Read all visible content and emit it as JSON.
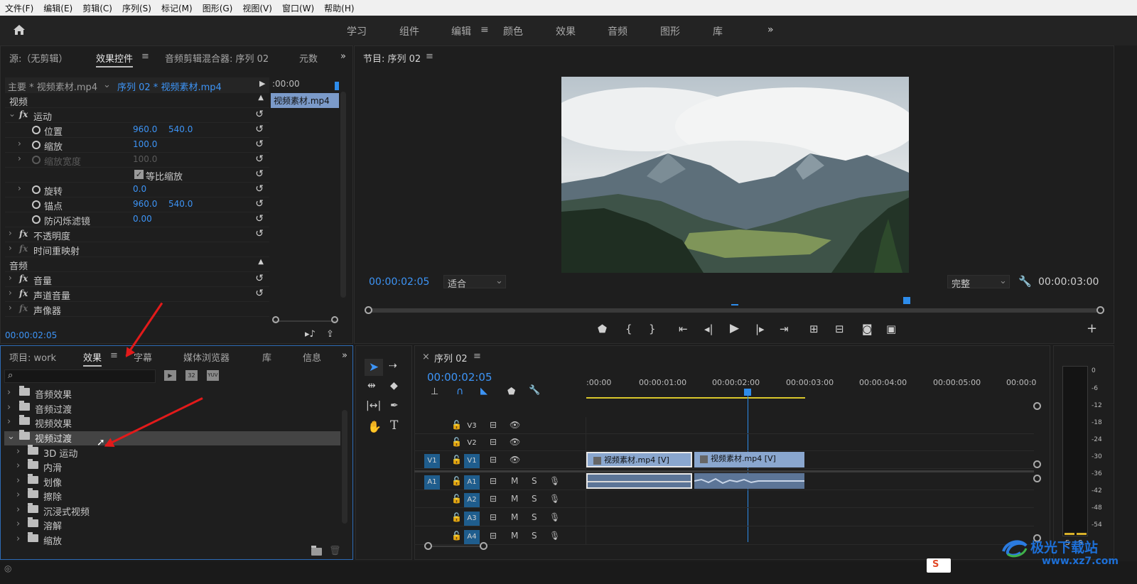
{
  "menu": [
    "文件(F)",
    "编辑(E)",
    "剪辑(C)",
    "序列(S)",
    "标记(M)",
    "图形(G)",
    "视图(V)",
    "窗口(W)",
    "帮助(H)"
  ],
  "workspaces": [
    "学习",
    "组件",
    "编辑",
    "颜色",
    "效果",
    "音频",
    "图形",
    "库"
  ],
  "active_workspace": "编辑",
  "source_panel": {
    "tabs": [
      "源:（无剪辑）",
      "效果控件",
      "音频剪辑混合器: 序列 02",
      "元数"
    ],
    "master": "主要 * 视频素材.mp4",
    "sequence_clip": "序列 02 * 视频素材.mp4",
    "mini_time": ":00:00",
    "mini_clip": "视频素材.mp4",
    "section_video": "视频",
    "motion": "运动",
    "position": "位置",
    "position_x": "960.0",
    "position_y": "540.0",
    "scale": "缩放",
    "scale_val": "100.0",
    "scale_width": "缩放宽度",
    "scale_width_val": "100.0",
    "uniform_scale": "等比缩放",
    "rotation": "旋转",
    "rotation_val": "0.0",
    "anchor": "锚点",
    "anchor_x": "960.0",
    "anchor_y": "540.0",
    "antiflicker": "防闪烁滤镜",
    "antiflicker_val": "0.00",
    "opacity": "不透明度",
    "time_remap": "时间重映射",
    "section_audio": "音频",
    "volume": "音量",
    "channel_volume": "声道音量",
    "panner": "声像器",
    "timecode": "00:00:02:05"
  },
  "program": {
    "title": "节目: 序列 02",
    "timecode": "00:00:02:05",
    "fit": "适合",
    "quality": "完整",
    "duration": "00:00:03:00"
  },
  "project_panel": {
    "tabs": [
      "项目: work",
      "效果",
      "字幕",
      "媒体浏览器",
      "库",
      "信息"
    ],
    "search_placeholder": "",
    "filter_icons": [
      "32",
      "32",
      "YUV"
    ],
    "folders": [
      "音频效果",
      "音频过渡",
      "视频效果",
      "视频过渡"
    ],
    "subfolders": [
      "3D 运动",
      "内滑",
      "划像",
      "擦除",
      "沉浸式视频",
      "溶解",
      "缩放"
    ]
  },
  "timeline": {
    "tab": "序列 02",
    "timecode": "00:00:02:05",
    "ruler": [
      ":00:00",
      "00:00:01:00",
      "00:00:02:00",
      "00:00:03:00",
      "00:00:04:00",
      "00:00:05:00",
      "00:00:0"
    ],
    "video_tracks": [
      "V3",
      "V2",
      "V1"
    ],
    "audio_tracks": [
      "A1",
      "A2",
      "A3",
      "A4"
    ],
    "src_v": "V1",
    "src_a": "A1",
    "clip1": "视频素材.mp4 [V]",
    "clip2": "视频素材.mp4 [V]",
    "m": "M",
    "s": "S"
  },
  "meter": {
    "scale": [
      "0",
      "-6",
      "-12",
      "-18",
      "-24",
      "-30",
      "-36",
      "-42",
      "-48",
      "-54"
    ],
    "s1": "S",
    "s2": "S"
  },
  "watermark": {
    "line1": "极光下载站",
    "line2": "www.xz7.com"
  }
}
